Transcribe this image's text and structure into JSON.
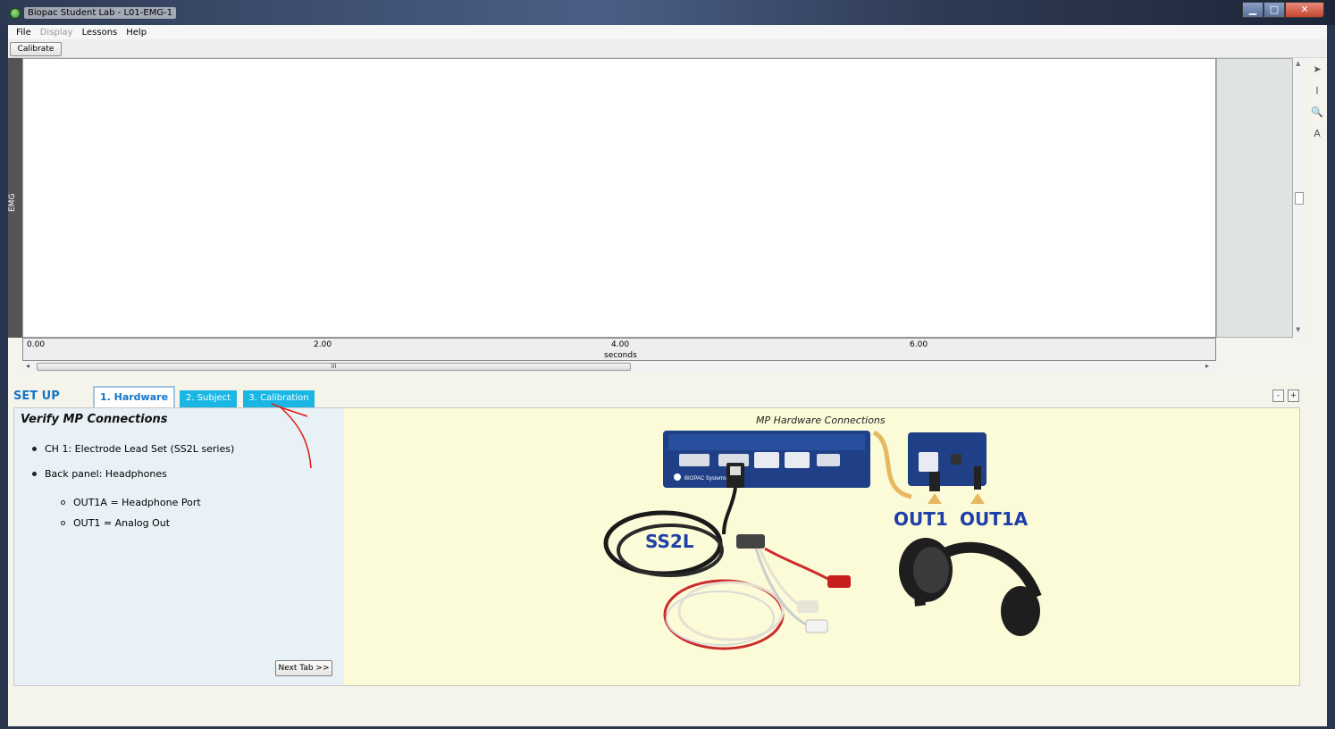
{
  "window": {
    "title": "Biopac Student Lab - L01-EMG-1"
  },
  "menu": {
    "items": [
      {
        "label": "File",
        "disabled": false
      },
      {
        "label": "Display",
        "disabled": true
      },
      {
        "label": "Lessons",
        "disabled": false
      },
      {
        "label": "Help",
        "disabled": false
      }
    ]
  },
  "toolbar": {
    "calibrate_label": "Calibrate"
  },
  "graph": {
    "channel_label": "EMG",
    "time_ticks": [
      "0.00",
      "2.00",
      "4.00",
      "6.00"
    ],
    "time_unit": "seconds",
    "scroll_grip": "III"
  },
  "setup": {
    "title": "SET UP",
    "tabs": [
      {
        "label": "1. Hardware",
        "active": true
      },
      {
        "label": "2. Subject",
        "active": false
      },
      {
        "label": "3. Calibration",
        "active": false
      }
    ],
    "collapse_minus": "-",
    "collapse_plus": "+",
    "heading": "Verify MP Connections",
    "bullets": [
      "CH 1: Electrode Lead Set (SS2L series)",
      "Back panel: Headphones"
    ],
    "sub_bullets": [
      "OUT1A = Headphone Port",
      "OUT1 = Analog Out"
    ],
    "next_tab_label": "Next Tab >>",
    "image_caption": "MP Hardware Connections",
    "image_labels": {
      "ss2l": "SS2L",
      "out1": "OUT1",
      "out1a": "OUT1A",
      "device_text": "BIOPAC Systems"
    }
  },
  "colors": {
    "accent_blue": "#1475c8",
    "tab_cyan": "#1ab7e4",
    "image_bg": "#fcfbd8",
    "annotation_red": "#e01818"
  }
}
